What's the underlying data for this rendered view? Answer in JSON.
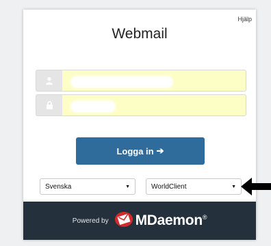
{
  "header": {
    "help_label": "Hjälp",
    "title": "Webmail"
  },
  "form": {
    "username": {
      "value": "",
      "placeholder": ""
    },
    "password": {
      "value": "",
      "placeholder": ""
    },
    "login_label": "Logga in",
    "login_arrow": "➔"
  },
  "selects": {
    "language": {
      "selected": "Svenska"
    },
    "theme": {
      "selected": "WorldClient"
    }
  },
  "footer": {
    "powered_by": "Powered by",
    "brand": "MDaemon",
    "registered": "®"
  },
  "colors": {
    "login_button": "#2f6b9b",
    "input_autofill": "#fdfec6",
    "footer_bg": "#24313d",
    "logo_red": "#d32b2b"
  },
  "icons": {
    "user": "user-icon",
    "lock": "lock-icon",
    "caret": "caret-down-icon",
    "logo": "mdaemon-envelope-icon",
    "pointer": "pointer-arrow-icon"
  }
}
